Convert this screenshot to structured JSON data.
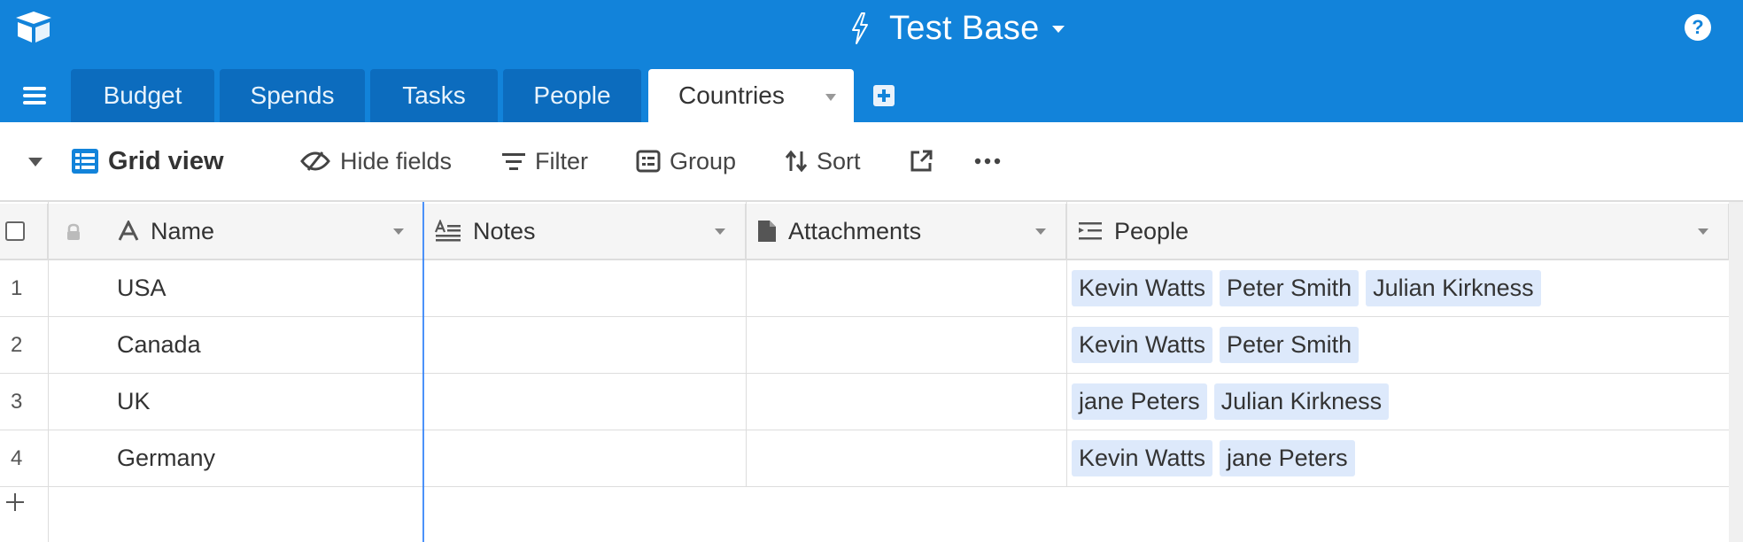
{
  "app": {
    "base_title": "Test Base",
    "help_label": "?",
    "brand_color": "#1283da"
  },
  "tabs": [
    {
      "label": "Budget",
      "active": false
    },
    {
      "label": "Spends",
      "active": false
    },
    {
      "label": "Tasks",
      "active": false
    },
    {
      "label": "People",
      "active": false
    },
    {
      "label": "Countries",
      "active": true
    }
  ],
  "toolbar": {
    "view_name": "Grid view",
    "hide_fields": "Hide fields",
    "filter": "Filter",
    "group": "Group",
    "sort": "Sort",
    "share_icon": "share-icon",
    "more_icon": "more-icon"
  },
  "columns": [
    {
      "label": "Name",
      "icon": "text-field-icon"
    },
    {
      "label": "Notes",
      "icon": "long-text-icon"
    },
    {
      "label": "Attachments",
      "icon": "attachment-icon"
    },
    {
      "label": "People",
      "icon": "linked-record-icon"
    }
  ],
  "rows": [
    {
      "num": "1",
      "name": "USA",
      "people": [
        "Kevin Watts",
        "Peter Smith",
        "Julian Kirkness"
      ]
    },
    {
      "num": "2",
      "name": "Canada",
      "people": [
        "Kevin Watts",
        "Peter Smith"
      ]
    },
    {
      "num": "3",
      "name": "UK",
      "people": [
        "jane Peters",
        "Julian Kirkness"
      ]
    },
    {
      "num": "4",
      "name": "Germany",
      "people": [
        "Kevin Watts",
        "jane Peters"
      ]
    }
  ],
  "add_row_icon": "plus-icon"
}
